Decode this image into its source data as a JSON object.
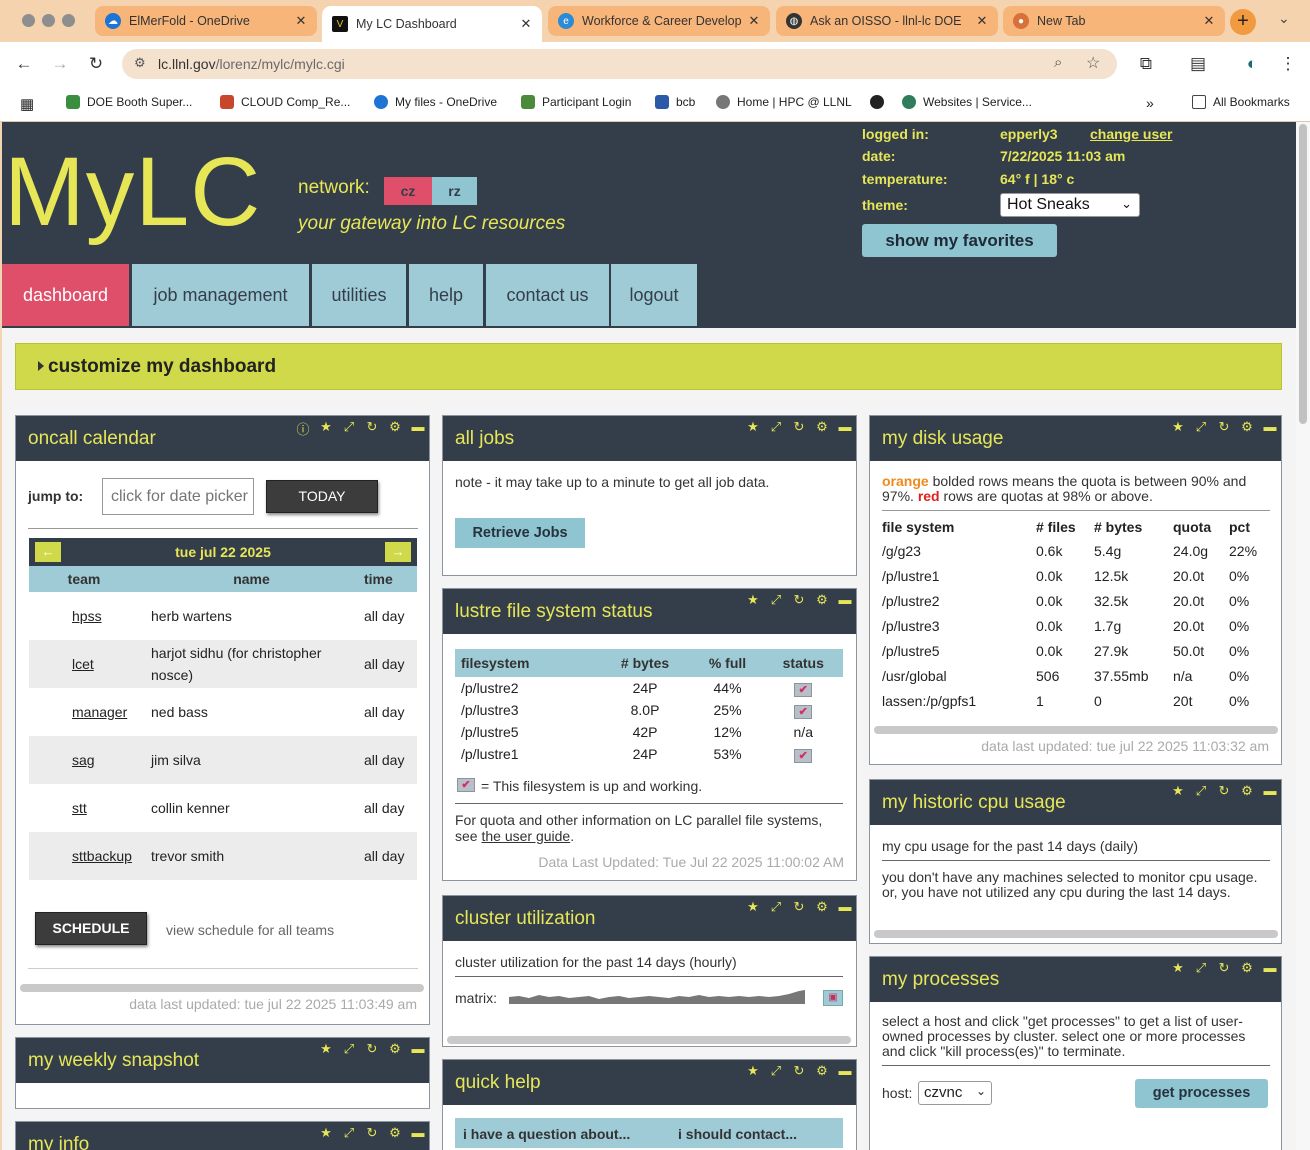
{
  "browser": {
    "tabs": [
      {
        "title": "ElMerFold - OneDrive",
        "icon": "onedrive-icon"
      },
      {
        "title": "My LC Dashboard",
        "icon": "llnl-icon"
      },
      {
        "title": "Workforce & Career Develop",
        "icon": "edge-icon"
      },
      {
        "title": "Ask an OISSO - llnl-lc DOE",
        "icon": "globe-icon"
      },
      {
        "title": "New Tab",
        "icon": "chrome-icon"
      }
    ],
    "url_host": "lc.llnl.gov",
    "url_path": "/lorenz/mylc/mylc.cgi",
    "bookmarks": [
      "DOE Booth Super...",
      "CLOUD Comp_Re...",
      "My files - OneDrive",
      "Participant Login",
      "bcb",
      "Home | HPC @ LLNL",
      "Websites | Service..."
    ],
    "all_bookmarks": "All Bookmarks"
  },
  "header": {
    "logo": "MyLC",
    "network_label": "network:",
    "network_cz": "cz",
    "network_rz": "rz",
    "tagline": "your gateway into LC resources",
    "logged_in_label": "logged in:",
    "logged_in_value": "epperly3",
    "change_user": "change user",
    "date_label": "date:",
    "date_value": "7/22/2025 11:03 am",
    "temperature_label": "temperature:",
    "temperature_value": "64° f | 18° c",
    "theme_label": "theme:",
    "theme_value": "Hot Sneaks",
    "favorites_button": "show my favorites"
  },
  "nav": [
    "dashboard",
    "job management",
    "utilities",
    "help",
    "contact us",
    "logout"
  ],
  "customize": "customize my dashboard",
  "oncall": {
    "title": "oncall calendar",
    "jump_label": "jump to:",
    "date_placeholder": "click for date picker",
    "today": "TODAY",
    "date": "tue jul 22 2025",
    "headers": [
      "team",
      "name",
      "time"
    ],
    "rows": [
      {
        "team": "hpss",
        "name": "herb wartens",
        "time": "all day"
      },
      {
        "team": "lcet",
        "name": "harjot sidhu (for christopher nosce)",
        "time": "all day"
      },
      {
        "team": "manager",
        "name": "ned bass",
        "time": "all day"
      },
      {
        "team": "sag",
        "name": "jim silva",
        "time": "all day"
      },
      {
        "team": "stt",
        "name": "collin kenner",
        "time": "all day"
      },
      {
        "team": "sttbackup",
        "name": "trevor smith",
        "time": "all day"
      }
    ],
    "schedule": "SCHEDULE",
    "view_schedule": "view schedule for all teams",
    "updated": "data last updated: tue jul 22 2025 11:03:49 am"
  },
  "weekly": {
    "title": "my weekly snapshot"
  },
  "myinfo": {
    "title": "my info"
  },
  "alljobs": {
    "title": "all jobs",
    "note": "note - it may take up to a minute to get all job data.",
    "button": "Retrieve Jobs"
  },
  "lustre": {
    "title": "lustre file system status",
    "headers": [
      "filesystem",
      "# bytes",
      "% full",
      "status"
    ],
    "rows": [
      {
        "fs": "/p/lustre2",
        "bytes": "24P",
        "full": "44%",
        "status": "check"
      },
      {
        "fs": "/p/lustre3",
        "bytes": "8.0P",
        "full": "25%",
        "status": "check"
      },
      {
        "fs": "/p/lustre5",
        "bytes": "42P",
        "full": "12%",
        "status": "n/a"
      },
      {
        "fs": "/p/lustre1",
        "bytes": "24P",
        "full": "53%",
        "status": "check"
      }
    ],
    "legend": "= This filesystem is up and working.",
    "info_text": "For quota and other information on LC parallel file systems, see",
    "info_link": "the user guide",
    "updated": "Data Last Updated: Tue Jul 22 2025 11:00:02 AM"
  },
  "cluster": {
    "title": "cluster utilization",
    "desc": "cluster utilization for the past 14 days (hourly)",
    "matrix_label": "matrix:"
  },
  "quickhelp": {
    "title": "quick help",
    "col1": "i have a question about...",
    "col2": "i should contact..."
  },
  "disk": {
    "title": "my disk usage",
    "note_orange": "orange",
    "note_1": " bolded rows means the quota is between 90% and 97%. ",
    "note_red": "red",
    "note_2": " rows are quotas at 98% or above.",
    "headers": [
      "file system",
      "# files",
      "# bytes",
      "quota",
      "pct"
    ],
    "rows": [
      {
        "fs": "/g/g23",
        "files": "0.6k",
        "bytes": "5.4g",
        "quota": "24.0g",
        "pct": "22%"
      },
      {
        "fs": "/p/lustre1",
        "files": "0.0k",
        "bytes": "12.5k",
        "quota": "20.0t",
        "pct": "0%"
      },
      {
        "fs": "/p/lustre2",
        "files": "0.0k",
        "bytes": "32.5k",
        "quota": "20.0t",
        "pct": "0%"
      },
      {
        "fs": "/p/lustre3",
        "files": "0.0k",
        "bytes": "1.7g",
        "quota": "20.0t",
        "pct": "0%"
      },
      {
        "fs": "/p/lustre5",
        "files": "0.0k",
        "bytes": "27.9k",
        "quota": "50.0t",
        "pct": "0%"
      },
      {
        "fs": "/usr/global",
        "files": "506",
        "bytes": "37.55mb",
        "quota": "n/a",
        "pct": "0%"
      },
      {
        "fs": "lassen:/p/gpfs1",
        "files": "1",
        "bytes": "0",
        "quota": "20t",
        "pct": "0%"
      }
    ],
    "updated": "data last updated: tue jul 22 2025 11:03:32 am"
  },
  "cpu": {
    "title": "my historic cpu usage",
    "desc": "my cpu usage for the past 14 days (daily)",
    "msg": "you don't have any machines selected to monitor cpu usage. or, you have not utilized any cpu during the last 14 days."
  },
  "processes": {
    "title": "my processes",
    "desc": "select a host and click \"get processes\" to get a list of user-owned processes by cluster. select one or more processes and click \"kill process(es)\" to terminate.",
    "host_label": "host:",
    "host_value": "czvnc",
    "button": "get processes"
  },
  "colors": {
    "accent": "#e6e657",
    "dark": "#343e4b",
    "blue": "#9ecbd6",
    "pink": "#e04f6a",
    "lime": "#cfd94a"
  }
}
